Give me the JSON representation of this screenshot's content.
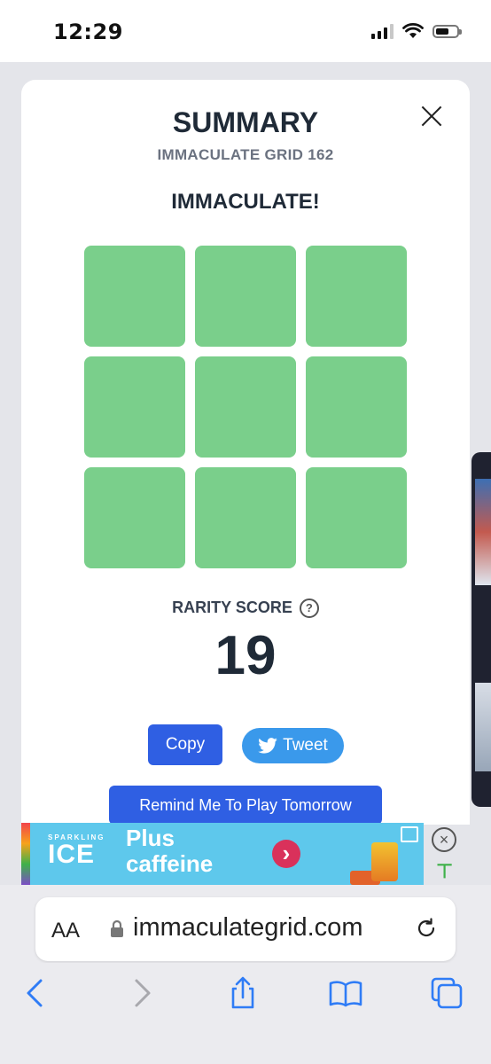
{
  "status_bar": {
    "time": "12:29"
  },
  "modal": {
    "title": "SUMMARY",
    "subtitle": "IMMACULATE GRID 162",
    "result": "IMMACULATE!",
    "grid": {
      "cell_color": "#7acf8b",
      "cells": [
        {
          "state": "correct"
        },
        {
          "state": "correct"
        },
        {
          "state": "correct"
        },
        {
          "state": "correct"
        },
        {
          "state": "correct"
        },
        {
          "state": "correct"
        },
        {
          "state": "correct"
        },
        {
          "state": "correct"
        },
        {
          "state": "correct"
        }
      ]
    },
    "rarity_label": "RARITY SCORE",
    "rarity_help": "?",
    "rarity_score": "19",
    "copy_label": "Copy",
    "tweet_label": "Tweet",
    "remind_label": "Remind Me To Play Tomorrow"
  },
  "ad": {
    "brand_small": "SPARKLING",
    "brand_big": "ICE",
    "headline_line1": "Plus",
    "headline_line2": "caffeine",
    "arrow": "›",
    "close": "×"
  },
  "browser": {
    "aa_label": "AA",
    "url": "immaculategrid.com"
  },
  "colors": {
    "primary_button": "#2f5fe3",
    "tweet_button": "#3a99eb",
    "correct_cell": "#7acf8b",
    "ios_blue": "#2f7cf6"
  }
}
